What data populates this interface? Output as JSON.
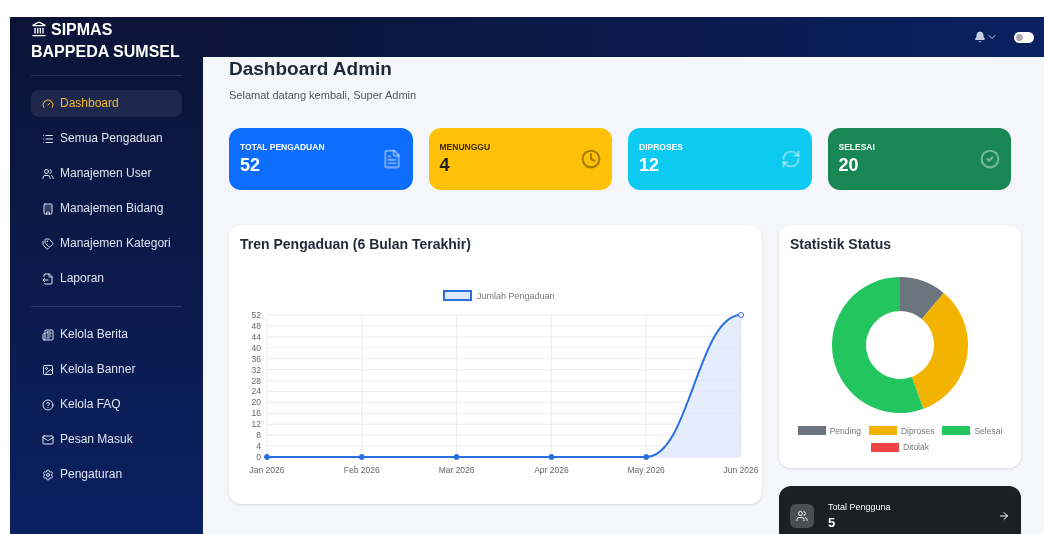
{
  "sidebar": {
    "brand": "SIPMAS BAPPEDA SUMSEL",
    "groups": [
      [
        {
          "label": "Dashboard",
          "selected": true
        },
        {
          "label": "Semua Pengaduan",
          "selected": false
        },
        {
          "label": "Manajemen User",
          "selected": false
        },
        {
          "label": "Manajemen Bidang",
          "selected": false
        },
        {
          "label": "Manajemen Kategori",
          "selected": false
        },
        {
          "label": "Laporan",
          "selected": false
        }
      ],
      [
        {
          "label": "Kelola Berita",
          "selected": false
        },
        {
          "label": "Kelola Banner",
          "selected": false
        },
        {
          "label": "Kelola FAQ",
          "selected": false
        },
        {
          "label": "Pesan Masuk",
          "selected": false
        },
        {
          "label": "Pengaturan",
          "selected": false
        }
      ]
    ]
  },
  "header": {
    "toggle": {
      "on": false
    }
  },
  "page": {
    "title": "Dashboard Admin",
    "subtitle": "Selamat datang kembali, Super Admin"
  },
  "stats": [
    {
      "label": "TOTAL PENGADUAN",
      "value": "52",
      "color": "#0d6efd"
    },
    {
      "label": "MENUNGGU",
      "value": "4",
      "color": "#ffc107"
    },
    {
      "label": "DIPROSES",
      "value": "12",
      "color": "#0dcaf0"
    },
    {
      "label": "SELESAI",
      "value": "20",
      "color": "#198754"
    }
  ],
  "trend": {
    "title": "Tren Pengaduan (6 Bulan Terakhir)",
    "chart_data": {
      "type": "area",
      "categories": [
        "Jan 2026",
        "Feb 2026",
        "Mar 2026",
        "Apr 2026",
        "May 2026",
        "Jun 2026"
      ],
      "series": [
        {
          "name": "Jumlah Pengaduan",
          "color": "#2a6fe0",
          "values": [
            0,
            0,
            0,
            0,
            0,
            52
          ]
        }
      ],
      "grid": true,
      "legend": true,
      "ylim": [
        0,
        52
      ],
      "yticks": [
        {
          "value": 0,
          "label": "0"
        },
        {
          "value": 4,
          "label": "4"
        },
        {
          "value": 8,
          "label": "8"
        },
        {
          "value": 12,
          "label": "12"
        },
        {
          "value": 16,
          "label": "16"
        },
        {
          "value": 20,
          "label": "20"
        },
        {
          "value": 24,
          "label": "24"
        },
        {
          "value": 28,
          "label": "28"
        },
        {
          "value": 32,
          "label": "32"
        },
        {
          "value": 36,
          "label": "36"
        },
        {
          "value": 40,
          "label": "40"
        },
        {
          "value": 44,
          "label": "44"
        },
        {
          "value": 48,
          "label": "48"
        },
        {
          "value": 52,
          "label": "52"
        }
      ]
    }
  },
  "status": {
    "title": "Statistik Status",
    "chart_data": {
      "type": "donut",
      "categories": [
        "Pending",
        "Diproses",
        "Selesai",
        "Ditolak"
      ],
      "series": [
        {
          "values": [
            11.1,
            33.3,
            55.6,
            0
          ]
        }
      ],
      "legend": true,
      "colors": [
        "#6c757d",
        "#f2b400",
        "#22c55e",
        "#ef4444"
      ]
    }
  },
  "users": {
    "label": "Total Pengguna",
    "value": "5"
  }
}
